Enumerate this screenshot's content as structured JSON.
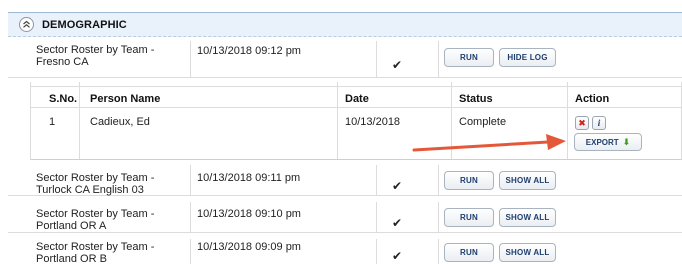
{
  "section": {
    "title": "DEMOGRAPHIC",
    "collapse_icon": "double-chevron-up-icon"
  },
  "rosters": [
    {
      "name": "Sector Roster by Team - Fresno CA",
      "date": "10/13/2018 09:12 pm",
      "check": "✔",
      "run_label": "RUN",
      "toggle_label": "HIDE LOG"
    },
    {
      "name": "Sector Roster by Team - Turlock CA English 03",
      "date": "10/13/2018 09:11 pm",
      "check": "✔",
      "run_label": "RUN",
      "toggle_label": "SHOW ALL"
    },
    {
      "name": "Sector Roster by Team - Portland OR A",
      "date": "10/13/2018 09:10 pm",
      "check": "✔",
      "run_label": "RUN",
      "toggle_label": "SHOW ALL"
    },
    {
      "name": "Sector Roster by Team - Portland OR B",
      "date": "10/13/2018 09:09 pm",
      "check": "✔",
      "run_label": "RUN",
      "toggle_label": "SHOW ALL"
    }
  ],
  "log": {
    "headers": {
      "sno": "S.No.",
      "person": "Person Name",
      "date": "Date",
      "status": "Status",
      "action": "Action"
    },
    "rows": [
      {
        "sno": "1",
        "person": "Cadieux, Ed",
        "date": "10/13/2018",
        "status": "Complete",
        "delete_glyph": "✖",
        "info_glyph": "i",
        "export_label": "EXPORT",
        "export_glyph": "⬇"
      }
    ]
  },
  "colors": {
    "accent_text": "#1e3f6e",
    "header_bg": "#e9f2fb",
    "delete_red": "#d0201a",
    "export_green": "#3a9a1e",
    "arrow": "#e4583a"
  }
}
